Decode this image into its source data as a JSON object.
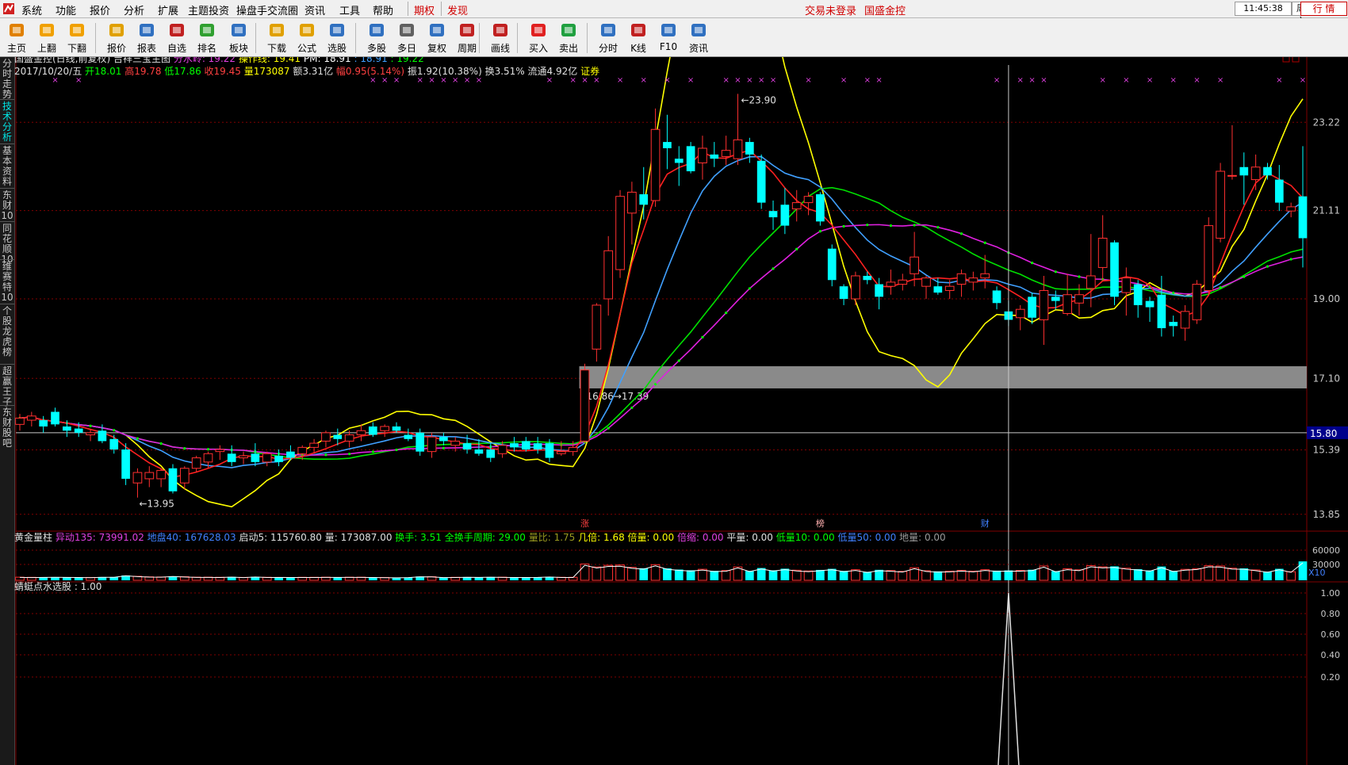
{
  "menu": {
    "items": [
      "系统",
      "功能",
      "报价",
      "分析",
      "扩展",
      "主题投资",
      "操盘手交流圈",
      "资讯",
      "工具",
      "帮助"
    ],
    "qiquan": "期权",
    "faxian": "发现",
    "login": "交易未登录",
    "stock": "国盛金控",
    "time": "11:45:38",
    "weekday": "周六",
    "hangqing": "行 情"
  },
  "toolbar": {
    "items": [
      {
        "label": "主页",
        "icon": "home-icon",
        "color": "#e08000"
      },
      {
        "label": "上翻",
        "icon": "up-arrow-icon",
        "color": "#f0a000"
      },
      {
        "label": "下翻",
        "icon": "down-arrow-icon",
        "color": "#f0a000"
      },
      {
        "label": "报价",
        "icon": "yen-icon",
        "color": "#e0a000"
      },
      {
        "label": "报表",
        "icon": "report-icon",
        "color": "#3070c0"
      },
      {
        "label": "自选",
        "icon": "f6-icon",
        "color": "#c02020"
      },
      {
        "label": "排名",
        "icon": "rank-icon",
        "color": "#30a030"
      },
      {
        "label": "板块",
        "icon": "blocks-icon",
        "color": "#3070c0"
      },
      {
        "label": "下载",
        "icon": "download-icon",
        "color": "#e0a000"
      },
      {
        "label": "公式",
        "icon": "formula-icon",
        "color": "#e0a000"
      },
      {
        "label": "选股",
        "icon": "pick-stock-icon",
        "color": "#3070c0"
      },
      {
        "label": "多股",
        "icon": "multi-stock-icon",
        "color": "#3070c0"
      },
      {
        "label": "多日",
        "icon": "multi-day-icon",
        "color": "#606060"
      },
      {
        "label": "复权",
        "icon": "restore-icon",
        "color": "#3070c0"
      },
      {
        "label": "周期",
        "icon": "f8-icon",
        "color": "#c02020"
      },
      {
        "label": "画线",
        "icon": "draw-line-icon",
        "color": "#c02020"
      },
      {
        "label": "买入",
        "icon": "buy-icon",
        "color": "#e02020"
      },
      {
        "label": "卖出",
        "icon": "sell-icon",
        "color": "#20a040"
      },
      {
        "label": "分时",
        "icon": "timeshare-icon",
        "color": "#3070c0"
      },
      {
        "label": "K线",
        "icon": "kline-icon",
        "color": "#c02020"
      },
      {
        "label": "F10",
        "icon": "f10-icon",
        "color": "#3070c0"
      },
      {
        "label": "资讯",
        "icon": "news-icon",
        "color": "#3070c0"
      }
    ]
  },
  "sidebar": [
    "分时走势",
    "技术分析",
    "基本资料",
    "东财10",
    "同花顺10",
    "维赛特10",
    "个股龙虎榜",
    "超赢王子",
    "东财股吧"
  ],
  "sidebar_active": 1,
  "header": {
    "row1": [
      {
        "t": "国盛金控(日线,前复权) 吉祥三宝主图",
        "c": "#e0e0e0"
      },
      {
        "t": " 分水岭: 19.22",
        "c": "#e040e0"
      },
      {
        "t": "  操作线: 19.41",
        "c": "#ffff00"
      },
      {
        "t": "  PM: 18.91",
        "c": "#ffffff"
      },
      {
        "t": "     : 18.91",
        "c": "#40a0ff"
      },
      {
        "t": "  : 19.22",
        "c": "#00ff00"
      }
    ],
    "row2": [
      {
        "t": "2017/10/20/五",
        "c": "#e0e0e0"
      },
      {
        "t": " 开18.01",
        "c": "#00ff00"
      },
      {
        "t": " 高19.78",
        "c": "#ff4040"
      },
      {
        "t": " 低17.86",
        "c": "#00ff00"
      },
      {
        "t": " 收19.45",
        "c": "#ff4040"
      },
      {
        "t": " 量173087",
        "c": "#ffff00"
      },
      {
        "t": " 额3.31亿",
        "c": "#e0e0e0"
      },
      {
        "t": " 幅0.95(5.14%)",
        "c": "#ff4040"
      },
      {
        "t": " 振1.92(10.38%)",
        "c": "#e0e0e0"
      },
      {
        "t": " 换3.51%",
        "c": "#e0e0e0"
      },
      {
        "t": " 流通4.92亿",
        "c": "#e0e0e0"
      },
      {
        "t": " 证券",
        "c": "#ffff00"
      }
    ]
  },
  "chart_data": {
    "type": "candlestick",
    "title": "国盛金控(日线,前复权) 吉祥三宝主图",
    "y_ticks": [
      23.22,
      21.11,
      19.0,
      17.1,
      15.39,
      13.85
    ],
    "ylim": [
      13.6,
      24.4
    ],
    "current_price": 15.8,
    "candles": [
      {
        "o": 16.0,
        "h": 16.25,
        "l": 15.85,
        "c": 16.15
      },
      {
        "o": 16.1,
        "h": 16.3,
        "l": 15.95,
        "c": 16.2
      },
      {
        "o": 16.1,
        "h": 16.2,
        "l": 15.8,
        "c": 15.95
      },
      {
        "o": 16.3,
        "h": 16.4,
        "l": 15.95,
        "c": 16.0
      },
      {
        "o": 15.95,
        "h": 16.1,
        "l": 15.7,
        "c": 15.85
      },
      {
        "o": 15.9,
        "h": 16.05,
        "l": 15.7,
        "c": 15.8
      },
      {
        "o": 15.75,
        "h": 15.9,
        "l": 15.6,
        "c": 15.8
      },
      {
        "o": 15.85,
        "h": 16.0,
        "l": 15.55,
        "c": 15.6
      },
      {
        "o": 15.65,
        "h": 15.75,
        "l": 15.3,
        "c": 15.4
      },
      {
        "o": 15.4,
        "h": 15.55,
        "l": 14.55,
        "c": 14.7
      },
      {
        "o": 14.6,
        "h": 14.95,
        "l": 14.25,
        "c": 14.85
      },
      {
        "o": 14.7,
        "h": 15.0,
        "l": 14.5,
        "c": 14.85
      },
      {
        "o": 14.7,
        "h": 14.95,
        "l": 14.5,
        "c": 14.9
      },
      {
        "o": 14.95,
        "h": 15.05,
        "l": 14.35,
        "c": 14.4
      },
      {
        "o": 14.6,
        "h": 15.0,
        "l": 14.45,
        "c": 14.95
      },
      {
        "o": 14.95,
        "h": 15.25,
        "l": 14.85,
        "c": 15.2
      },
      {
        "o": 15.1,
        "h": 15.35,
        "l": 14.95,
        "c": 15.3
      },
      {
        "o": 15.35,
        "h": 15.5,
        "l": 15.15,
        "c": 15.4
      },
      {
        "o": 15.3,
        "h": 15.5,
        "l": 15.0,
        "c": 15.1
      },
      {
        "o": 15.2,
        "h": 15.35,
        "l": 15.05,
        "c": 15.25
      },
      {
        "o": 15.3,
        "h": 15.55,
        "l": 15.0,
        "c": 15.1
      },
      {
        "o": 15.1,
        "h": 15.35,
        "l": 15.0,
        "c": 15.3
      },
      {
        "o": 15.25,
        "h": 15.4,
        "l": 15.0,
        "c": 15.1
      },
      {
        "o": 15.35,
        "h": 15.5,
        "l": 15.15,
        "c": 15.2
      },
      {
        "o": 15.3,
        "h": 15.5,
        "l": 15.15,
        "c": 15.45
      },
      {
        "o": 15.45,
        "h": 15.65,
        "l": 15.3,
        "c": 15.55
      },
      {
        "o": 15.6,
        "h": 15.85,
        "l": 15.45,
        "c": 15.8
      },
      {
        "o": 15.75,
        "h": 15.9,
        "l": 15.5,
        "c": 15.65
      },
      {
        "o": 15.6,
        "h": 15.85,
        "l": 15.45,
        "c": 15.75
      },
      {
        "o": 15.75,
        "h": 16.0,
        "l": 15.6,
        "c": 15.85
      },
      {
        "o": 15.95,
        "h": 16.05,
        "l": 15.7,
        "c": 15.75
      },
      {
        "o": 15.85,
        "h": 16.0,
        "l": 15.7,
        "c": 15.95
      },
      {
        "o": 15.95,
        "h": 16.05,
        "l": 15.8,
        "c": 15.85
      },
      {
        "o": 15.75,
        "h": 15.9,
        "l": 15.6,
        "c": 15.65
      },
      {
        "o": 15.8,
        "h": 15.9,
        "l": 15.25,
        "c": 15.35
      },
      {
        "o": 15.35,
        "h": 15.8,
        "l": 15.2,
        "c": 15.7
      },
      {
        "o": 15.7,
        "h": 15.8,
        "l": 15.5,
        "c": 15.6
      },
      {
        "o": 15.5,
        "h": 15.7,
        "l": 15.35,
        "c": 15.6
      },
      {
        "o": 15.55,
        "h": 15.75,
        "l": 15.3,
        "c": 15.4
      },
      {
        "o": 15.4,
        "h": 15.65,
        "l": 15.25,
        "c": 15.3
      },
      {
        "o": 15.4,
        "h": 15.55,
        "l": 15.1,
        "c": 15.2
      },
      {
        "o": 15.3,
        "h": 15.6,
        "l": 15.2,
        "c": 15.5
      },
      {
        "o": 15.55,
        "h": 15.7,
        "l": 15.35,
        "c": 15.45
      },
      {
        "o": 15.6,
        "h": 15.7,
        "l": 15.35,
        "c": 15.4
      },
      {
        "o": 15.55,
        "h": 15.7,
        "l": 15.3,
        "c": 15.4
      },
      {
        "o": 15.55,
        "h": 15.65,
        "l": 15.1,
        "c": 15.2
      },
      {
        "o": 15.3,
        "h": 15.6,
        "l": 15.25,
        "c": 15.35
      },
      {
        "o": 15.35,
        "h": 15.6,
        "l": 15.25,
        "c": 15.45
      },
      {
        "o": 15.6,
        "h": 17.45,
        "l": 15.55,
        "c": 17.3
      },
      {
        "o": 17.8,
        "h": 18.9,
        "l": 17.5,
        "c": 18.85
      },
      {
        "o": 19.0,
        "h": 20.5,
        "l": 18.6,
        "c": 20.15
      },
      {
        "o": 19.7,
        "h": 21.6,
        "l": 19.5,
        "c": 21.45
      },
      {
        "o": 21.05,
        "h": 21.8,
        "l": 20.3,
        "c": 21.55
      },
      {
        "o": 21.5,
        "h": 22.15,
        "l": 20.9,
        "c": 21.25
      },
      {
        "o": 21.35,
        "h": 23.55,
        "l": 21.2,
        "c": 23.05
      },
      {
        "o": 22.75,
        "h": 23.4,
        "l": 22.1,
        "c": 22.6
      },
      {
        "o": 22.35,
        "h": 22.65,
        "l": 21.7,
        "c": 22.25
      },
      {
        "o": 22.65,
        "h": 22.75,
        "l": 22.0,
        "c": 22.05
      },
      {
        "o": 22.25,
        "h": 22.9,
        "l": 21.85,
        "c": 22.6
      },
      {
        "o": 22.45,
        "h": 22.75,
        "l": 22.15,
        "c": 22.35
      },
      {
        "o": 22.4,
        "h": 22.9,
        "l": 22.2,
        "c": 22.55
      },
      {
        "o": 22.35,
        "h": 23.9,
        "l": 22.2,
        "c": 22.8
      },
      {
        "o": 22.75,
        "h": 22.85,
        "l": 22.25,
        "c": 22.45
      },
      {
        "o": 22.3,
        "h": 22.45,
        "l": 21.15,
        "c": 21.3
      },
      {
        "o": 21.1,
        "h": 21.35,
        "l": 20.65,
        "c": 20.95
      },
      {
        "o": 21.25,
        "h": 21.65,
        "l": 20.55,
        "c": 20.75
      },
      {
        "o": 21.15,
        "h": 21.6,
        "l": 20.85,
        "c": 21.3
      },
      {
        "o": 21.3,
        "h": 21.55,
        "l": 21.0,
        "c": 21.45
      },
      {
        "o": 21.5,
        "h": 21.55,
        "l": 20.75,
        "c": 20.85
      },
      {
        "o": 20.2,
        "h": 20.3,
        "l": 19.3,
        "c": 19.45
      },
      {
        "o": 19.3,
        "h": 19.35,
        "l": 18.85,
        "c": 19.0
      },
      {
        "o": 19.0,
        "h": 19.65,
        "l": 18.85,
        "c": 19.55
      },
      {
        "o": 19.55,
        "h": 19.65,
        "l": 19.35,
        "c": 19.45
      },
      {
        "o": 19.35,
        "h": 19.5,
        "l": 18.75,
        "c": 19.05
      },
      {
        "o": 19.3,
        "h": 19.7,
        "l": 19.1,
        "c": 19.4
      },
      {
        "o": 19.35,
        "h": 19.6,
        "l": 19.2,
        "c": 19.45
      },
      {
        "o": 19.6,
        "h": 20.6,
        "l": 19.3,
        "c": 20.0
      },
      {
        "o": 19.3,
        "h": 19.55,
        "l": 19.0,
        "c": 19.5
      },
      {
        "o": 19.3,
        "h": 19.5,
        "l": 19.1,
        "c": 19.15
      },
      {
        "o": 19.2,
        "h": 19.45,
        "l": 19.0,
        "c": 19.3
      },
      {
        "o": 19.35,
        "h": 19.7,
        "l": 19.05,
        "c": 19.6
      },
      {
        "o": 19.4,
        "h": 19.65,
        "l": 19.2,
        "c": 19.5
      },
      {
        "o": 19.5,
        "h": 20.05,
        "l": 19.25,
        "c": 19.6
      },
      {
        "o": 19.2,
        "h": 19.3,
        "l": 18.75,
        "c": 18.9
      },
      {
        "o": 18.7,
        "h": 18.95,
        "l": 18.35,
        "c": 18.5
      },
      {
        "o": 18.55,
        "h": 18.85,
        "l": 18.25,
        "c": 18.75
      },
      {
        "o": 19.05,
        "h": 19.15,
        "l": 18.4,
        "c": 18.55
      },
      {
        "o": 18.5,
        "h": 19.55,
        "l": 17.9,
        "c": 19.2
      },
      {
        "o": 19.05,
        "h": 19.2,
        "l": 18.75,
        "c": 18.95
      },
      {
        "o": 18.65,
        "h": 19.6,
        "l": 18.6,
        "c": 19.1
      },
      {
        "o": 18.9,
        "h": 19.35,
        "l": 18.6,
        "c": 19.1
      },
      {
        "o": 19.25,
        "h": 20.55,
        "l": 18.8,
        "c": 19.55
      },
      {
        "o": 19.75,
        "h": 21.0,
        "l": 19.45,
        "c": 20.45
      },
      {
        "o": 20.35,
        "h": 20.4,
        "l": 18.85,
        "c": 19.05
      },
      {
        "o": 19.15,
        "h": 19.75,
        "l": 18.6,
        "c": 19.5
      },
      {
        "o": 19.35,
        "h": 19.45,
        "l": 18.55,
        "c": 18.85
      },
      {
        "o": 18.95,
        "h": 19.05,
        "l": 18.45,
        "c": 18.8
      },
      {
        "o": 19.1,
        "h": 19.55,
        "l": 18.1,
        "c": 18.3
      },
      {
        "o": 18.45,
        "h": 18.6,
        "l": 18.1,
        "c": 18.35
      },
      {
        "o": 18.3,
        "h": 18.85,
        "l": 18.0,
        "c": 18.7
      },
      {
        "o": 18.5,
        "h": 19.45,
        "l": 18.4,
        "c": 19.35
      },
      {
        "o": 19.2,
        "h": 20.95,
        "l": 19.1,
        "c": 20.75
      },
      {
        "o": 20.45,
        "h": 22.25,
        "l": 20.35,
        "c": 22.05
      },
      {
        "o": 21.95,
        "h": 23.15,
        "l": 21.85,
        "c": 21.95
      },
      {
        "o": 22.15,
        "h": 22.5,
        "l": 21.25,
        "c": 21.95
      },
      {
        "o": 21.85,
        "h": 22.45,
        "l": 21.6,
        "c": 22.15
      },
      {
        "o": 22.15,
        "h": 22.25,
        "l": 21.85,
        "c": 21.95
      },
      {
        "o": 21.85,
        "h": 22.2,
        "l": 21.1,
        "c": 21.3
      },
      {
        "o": 21.1,
        "h": 21.3,
        "l": 20.95,
        "c": 21.2
      },
      {
        "o": 21.45,
        "h": 22.65,
        "l": 19.75,
        "c": 20.45
      }
    ],
    "labels": {
      "high": "23.90",
      "low": "13.95",
      "zone": "16.86→17.39"
    },
    "markers_bottom": [
      "涨",
      "榜",
      "财"
    ],
    "right_tag": "15.80"
  },
  "vol": {
    "items": [
      {
        "t": "黄金量柱",
        "c": "#e0e0e0"
      },
      {
        "t": "  异动135: 73991.02",
        "c": "#e040e0"
      },
      {
        "t": "  地盘40: 167628.03",
        "c": "#4080ff"
      },
      {
        "t": "  启动5: 115760.80",
        "c": "#e0e0e0"
      },
      {
        "t": "  量: 173087.00",
        "c": "#e0e0e0"
      },
      {
        "t": "  换手: 3.51",
        "c": "#00ff00"
      },
      {
        "t": "  全换手周期: 29.00",
        "c": "#00ff00"
      },
      {
        "t": "  量比: 1.75",
        "c": "#9a9a20"
      },
      {
        "t": "  几倍: 1.68",
        "c": "#ffff00"
      },
      {
        "t": "  倍量: 0.00",
        "c": "#ffff00"
      },
      {
        "t": "  倍缩: 0.00",
        "c": "#e040e0"
      },
      {
        "t": "  平量: 0.00",
        "c": "#e0e0e0"
      },
      {
        "t": "  低量10: 0.00",
        "c": "#00ff00"
      },
      {
        "t": "  低量50: 0.00",
        "c": "#4080ff"
      },
      {
        "t": "  地量: 0.00",
        "c": "#9a9a9a"
      }
    ],
    "ticks": [
      "60000",
      "30000"
    ],
    "scale": "X10"
  },
  "ind": {
    "title": "蜻蜓点水选股 : 1.00",
    "ticks": [
      "1.00",
      "0.80",
      "0.60",
      "0.40",
      "0.20"
    ]
  }
}
